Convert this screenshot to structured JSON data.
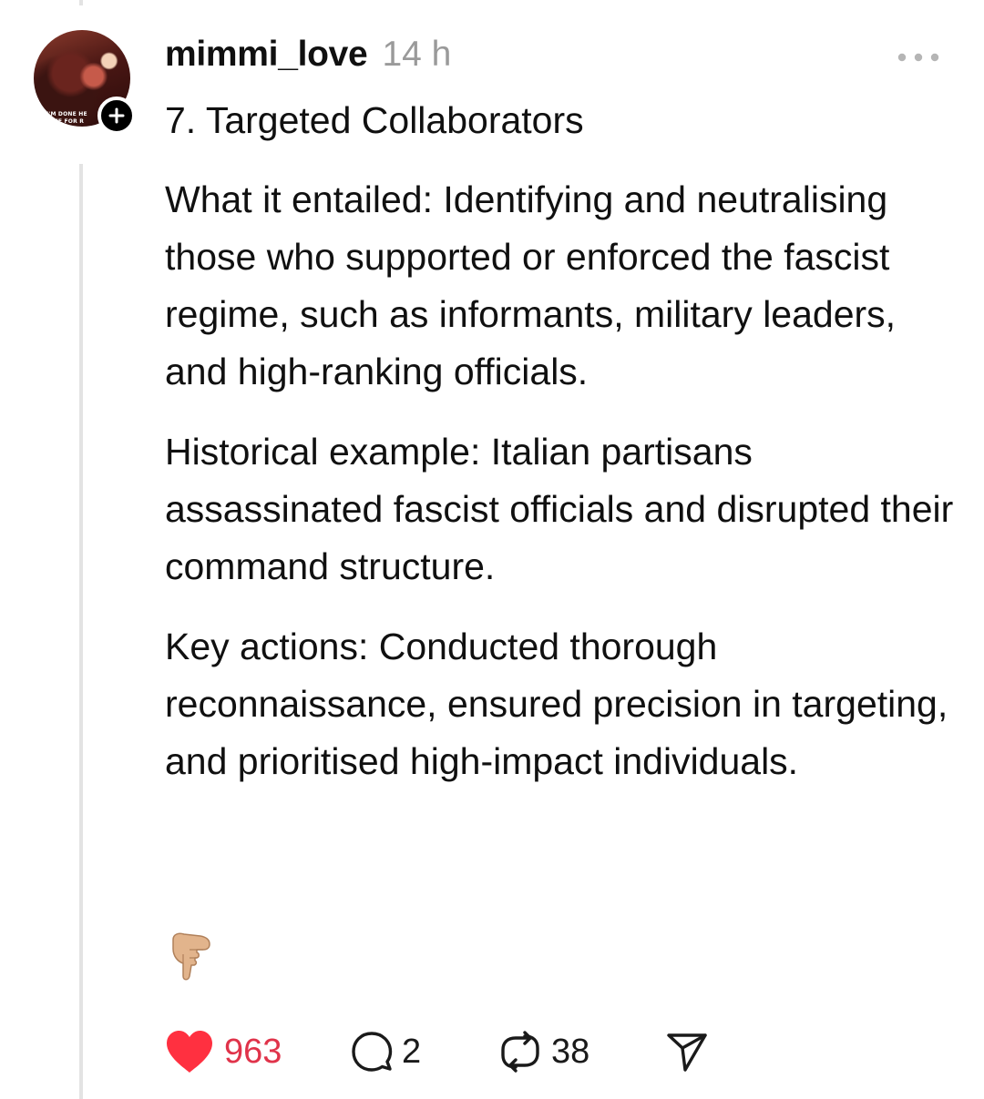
{
  "post": {
    "username": "mimmi_love",
    "timestamp": "14 h",
    "avatar_caption_line1": "I'M DONE HE",
    "avatar_caption_line2": "TIME FOR R",
    "title": "7. Targeted Collaborators",
    "paragraphs": [
      "What it entailed: Identifying and neutralising those who supported or enforced the fascist regime, such as informants, military leaders, and high-ranking officials.",
      "Historical example: Italian partisans assassinated fascist officials and disrupted their command structure.",
      "Key actions: Conducted thorough reconnaissance, ensured precision in targeting, and prioritised high-impact individuals."
    ],
    "emoji": "👇🏼"
  },
  "actions": {
    "likes": "963",
    "replies": "2",
    "reposts": "38"
  },
  "icons": {
    "more": "more-horizontal-icon",
    "follow": "plus-icon",
    "like": "heart-icon",
    "reply": "comment-bubble-icon",
    "repost": "repost-icon",
    "share": "send-icon",
    "emoji": "backhand-index-pointing-down"
  },
  "colors": {
    "like_active": "#ff3040",
    "like_count": "#e0334a",
    "timestamp": "#9a9a9a",
    "thread_line": "#e3e3e3"
  }
}
